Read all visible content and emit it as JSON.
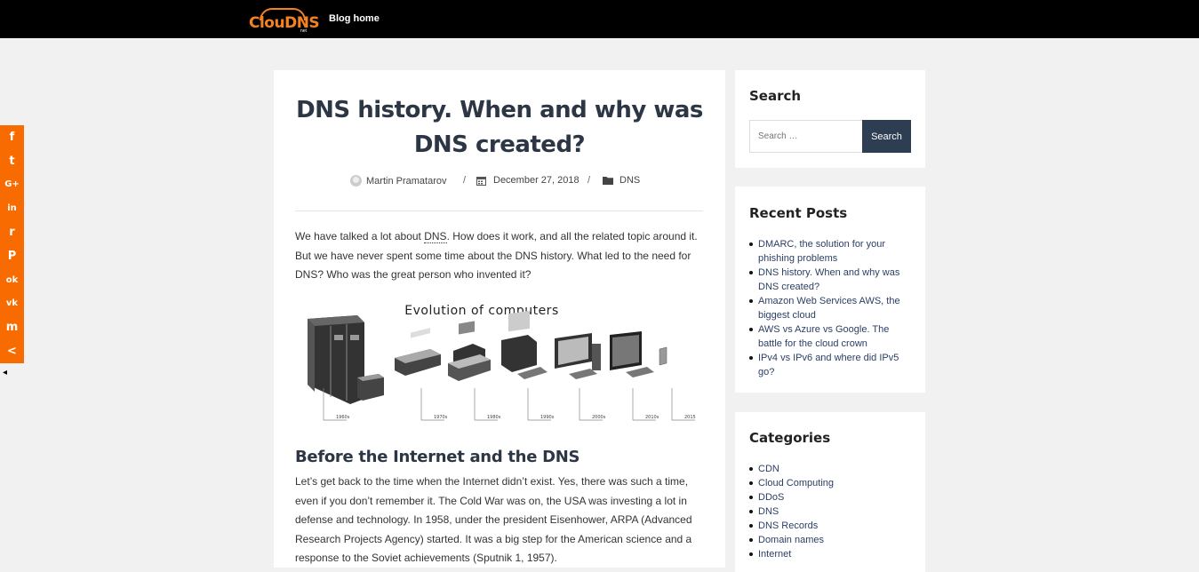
{
  "header": {
    "logo_text": "ClouDNS",
    "logo_sub": "net",
    "nav_home": "Blog home"
  },
  "share": {
    "items": [
      {
        "name": "facebook",
        "glyph": "f"
      },
      {
        "name": "twitter",
        "glyph": "t"
      },
      {
        "name": "google-plus",
        "glyph": "G+"
      },
      {
        "name": "linkedin",
        "glyph": "in"
      },
      {
        "name": "reddit",
        "glyph": "r"
      },
      {
        "name": "pinterest",
        "glyph": "P"
      },
      {
        "name": "odnoklassniki",
        "glyph": "ok"
      },
      {
        "name": "vk",
        "glyph": "vk"
      },
      {
        "name": "mix",
        "glyph": "m"
      },
      {
        "name": "more",
        "glyph": "<"
      }
    ],
    "hide_glyph": "◂"
  },
  "article": {
    "title": "DNS history. When and why was DNS created?",
    "author": "Martin Pramatarov",
    "date": "December 27, 2018",
    "category": "DNS",
    "separator": "/",
    "intro_before": "We have talked a lot about ",
    "intro_link": "DNS",
    "intro_after": ". How does it work, and all the related topic around it. But we have never spent some time about the DNS history. What led to the need for DNS? Who was the great person who invented it?",
    "figure": {
      "title": "Evolution of computers",
      "decades": [
        "1960s",
        "1970s",
        "1980s",
        "1990s",
        "2000s",
        "2010s",
        "2015"
      ]
    },
    "section_heading": "Before the Internet and the DNS",
    "section_text": "Let’s get back to the time when the Internet didn’t exist. Yes, there was such a time, even if you don’t remember it. The Cold War was on, the USA was investing a lot in defense and technology. In 1958, under the president Eisenhower, ARPA (Advanced Research Projects Agency) started. It was a big step for the American science and a response to the Soviet achievements (Sputnik 1, 1957)."
  },
  "sidebar": {
    "search": {
      "heading": "Search",
      "placeholder": "Search …",
      "button": "Search"
    },
    "recent": {
      "heading": "Recent Posts",
      "items": [
        "DMARC, the solution for your phishing problems",
        "DNS history. When and why was DNS created?",
        "Amazon Web Services AWS, the biggest cloud",
        "AWS vs Azure vs Google. The battle for the cloud crown",
        "IPv4 vs IPv6 and where did IPv5 go?"
      ]
    },
    "categories": {
      "heading": "Categories",
      "items": [
        "CDN",
        "Cloud Computing",
        "DDoS",
        "DNS",
        "DNS Records",
        "Domain names",
        "Internet"
      ]
    }
  },
  "colors": {
    "topbar": "#000000",
    "brand_orange": "#f58220",
    "share_orange": "#f86b00",
    "search_button": "#2e3e52",
    "heading": "#2c3644",
    "link": "#2c3e63"
  }
}
